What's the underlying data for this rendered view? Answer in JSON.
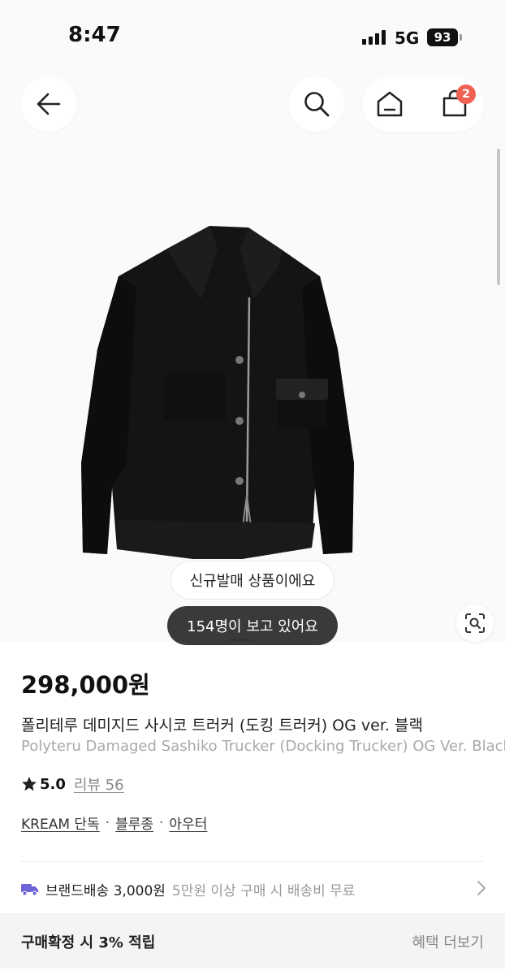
{
  "status_bar": {
    "time": "8:47",
    "network": "5G",
    "battery": "93"
  },
  "header": {
    "back_icon": "arrow-left-icon",
    "search_icon": "search-icon",
    "home_icon": "home-icon",
    "cart_icon": "shopping-bag-icon",
    "cart_count": "2",
    "cart_badge_color": "#ef6253"
  },
  "image": {
    "new_release_badge": "신규발매 상품이에요",
    "viewers_badge": "154명이 보고 있어요",
    "scan_icon": "lens-search-icon"
  },
  "product": {
    "price": "298,000원",
    "title_ko": "폴리테루 데미지드 사시코 트러커 (도킹 트러커) OG ver. 블랙",
    "title_en": "Polyteru Damaged Sashiko Trucker (Docking Trucker) OG Ver. Black",
    "rating": "5.0",
    "reviews": "리뷰 56",
    "tags": [
      "KREAM 단독",
      "블루종",
      "아우터"
    ]
  },
  "delivery": {
    "icon": "truck-icon",
    "icon_color": "#6c63d9",
    "label": "브랜드배송 3,000원",
    "note": "5만원 이상 구매 시 배송비 무료"
  },
  "benefit": {
    "label": "구매확정 시 3% 적립",
    "link": "혜택 더보기"
  }
}
